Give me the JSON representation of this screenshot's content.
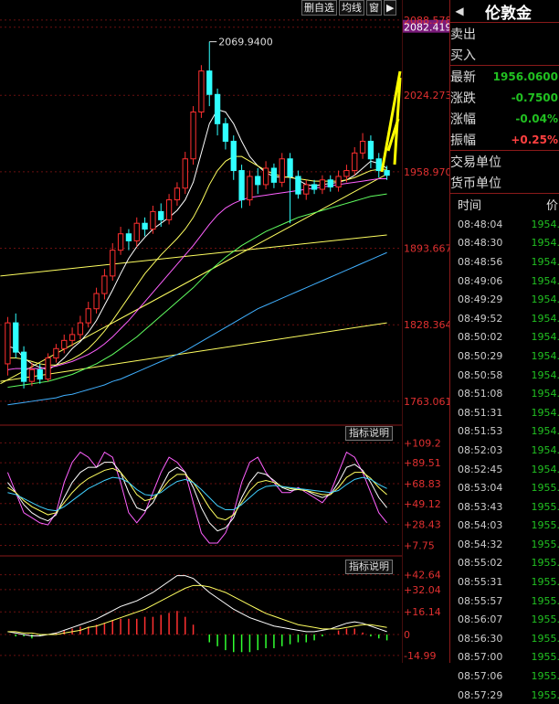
{
  "toolbar": {
    "delete": "删自选",
    "ma": "均线",
    "window": "窗",
    "arrow": "▶"
  },
  "panel": {
    "arrow": "◀",
    "title": "伦敦金",
    "sell": "卖出",
    "buy": "买入",
    "latest_label": "最新",
    "latest": "1956.0600",
    "change_label": "涨跌",
    "change": "-0.7500",
    "pct_label": "涨幅",
    "pct": "-0.04%",
    "amp_label": "振幅",
    "amp": "+0.25%",
    "trade_unit": "交易单位",
    "currency_unit": "货币单位",
    "time_header": "时间",
    "price_header": "价",
    "ticks": [
      {
        "t": "08:48:04",
        "p": "1954."
      },
      {
        "t": "08:48:30",
        "p": "1954."
      },
      {
        "t": "08:48:56",
        "p": "1954."
      },
      {
        "t": "08:49:06",
        "p": "1954."
      },
      {
        "t": "08:49:29",
        "p": "1954."
      },
      {
        "t": "08:49:52",
        "p": "1954."
      },
      {
        "t": "08:50:02",
        "p": "1954."
      },
      {
        "t": "08:50:29",
        "p": "1954."
      },
      {
        "t": "08:50:58",
        "p": "1954."
      },
      {
        "t": "08:51:08",
        "p": "1954."
      },
      {
        "t": "08:51:31",
        "p": "1954."
      },
      {
        "t": "08:51:53",
        "p": "1954."
      },
      {
        "t": "08:52:03",
        "p": "1954."
      },
      {
        "t": "08:52:45",
        "p": "1954."
      },
      {
        "t": "08:53:04",
        "p": "1955."
      },
      {
        "t": "08:53:43",
        "p": "1955."
      },
      {
        "t": "08:54:03",
        "p": "1955."
      },
      {
        "t": "08:54:32",
        "p": "1955."
      },
      {
        "t": "08:55:02",
        "p": "1955."
      },
      {
        "t": "08:55:31",
        "p": "1955."
      },
      {
        "t": "08:55:57",
        "p": "1955."
      },
      {
        "t": "08:56:07",
        "p": "1955."
      },
      {
        "t": "08:56:30",
        "p": "1955."
      },
      {
        "t": "08:57:00",
        "p": "1955."
      },
      {
        "t": "08:57:06",
        "p": "1955."
      },
      {
        "t": "08:57:29",
        "p": "1955."
      }
    ]
  },
  "indicator_btn": "指标说明",
  "chart_data": [
    {
      "type": "candlestick",
      "high_label": "2069.9400",
      "y_ticks": [
        "2088.578",
        "2082.419",
        "2024.273",
        "1958.970",
        "1893.667",
        "1828.364",
        "1763.061"
      ],
      "ylim": [
        1745,
        2090
      ],
      "candles": [
        [
          1795,
          1830,
          1785,
          1835
        ],
        [
          1830,
          1805,
          1800,
          1838
        ],
        [
          1805,
          1780,
          1774,
          1810
        ],
        [
          1780,
          1790,
          1776,
          1796
        ],
        [
          1790,
          1782,
          1778,
          1795
        ],
        [
          1782,
          1800,
          1780,
          1804
        ],
        [
          1800,
          1808,
          1796,
          1812
        ],
        [
          1808,
          1815,
          1804,
          1820
        ],
        [
          1815,
          1820,
          1810,
          1826
        ],
        [
          1820,
          1830,
          1816,
          1836
        ],
        [
          1830,
          1842,
          1826,
          1848
        ],
        [
          1842,
          1855,
          1838,
          1860
        ],
        [
          1855,
          1870,
          1850,
          1876
        ],
        [
          1870,
          1892,
          1866,
          1898
        ],
        [
          1892,
          1906,
          1888,
          1912
        ],
        [
          1906,
          1900,
          1892,
          1910
        ],
        [
          1900,
          1915,
          1895,
          1920
        ],
        [
          1915,
          1910,
          1904,
          1920
        ],
        [
          1910,
          1925,
          1906,
          1930
        ],
        [
          1925,
          1918,
          1912,
          1932
        ],
        [
          1918,
          1935,
          1914,
          1940
        ],
        [
          1935,
          1945,
          1930,
          1950
        ],
        [
          1945,
          1970,
          1940,
          1976
        ],
        [
          1970,
          2010,
          1965,
          2015
        ],
        [
          2010,
          2045,
          2005,
          2050
        ],
        [
          2045,
          2025,
          2015,
          2070
        ],
        [
          2025,
          2000,
          1990,
          2030
        ],
        [
          2000,
          1985,
          1978,
          2005
        ],
        [
          1985,
          1960,
          1952,
          1990
        ],
        [
          1960,
          1935,
          1928,
          1965
        ],
        [
          1935,
          1955,
          1930,
          1960
        ],
        [
          1955,
          1948,
          1940,
          1962
        ],
        [
          1948,
          1962,
          1944,
          1968
        ],
        [
          1962,
          1950,
          1945,
          1966
        ],
        [
          1950,
          1970,
          1946,
          1975
        ],
        [
          1970,
          1955,
          1915,
          1975
        ],
        [
          1955,
          1940,
          1936,
          1960
        ],
        [
          1940,
          1948,
          1935,
          1952
        ],
        [
          1948,
          1944,
          1940,
          1952
        ],
        [
          1944,
          1952,
          1940,
          1956
        ],
        [
          1952,
          1946,
          1942,
          1956
        ],
        [
          1946,
          1955,
          1942,
          1960
        ],
        [
          1955,
          1960,
          1950,
          1965
        ],
        [
          1960,
          1975,
          1956,
          1980
        ],
        [
          1975,
          1985,
          1970,
          1992
        ],
        [
          1985,
          1970,
          1962,
          1990
        ],
        [
          1970,
          1960,
          1954,
          1975
        ],
        [
          1960,
          1956,
          1952,
          1964
        ]
      ],
      "moving_averages": [
        {
          "color": "#ffffff",
          "values": [
            1810,
            1808,
            1800,
            1795,
            1792,
            1790,
            1794,
            1800,
            1808,
            1814,
            1822,
            1832,
            1845,
            1858,
            1872,
            1885,
            1895,
            1903,
            1910,
            1915,
            1920,
            1926,
            1935,
            1950,
            1975,
            2000,
            2012,
            2010,
            2000,
            1985,
            1972,
            1964,
            1958,
            1955,
            1954,
            1955,
            1952,
            1948,
            1947,
            1948,
            1949,
            1950,
            1952,
            1956,
            1962,
            1968,
            1966,
            1962
          ]
        },
        {
          "color": "#ffff60",
          "values": [
            1800,
            1800,
            1799,
            1797,
            1795,
            1794,
            1794,
            1796,
            1799,
            1803,
            1808,
            1815,
            1823,
            1832,
            1842,
            1852,
            1862,
            1872,
            1880,
            1888,
            1895,
            1902,
            1910,
            1920,
            1933,
            1948,
            1960,
            1968,
            1972,
            1972,
            1968,
            1964,
            1960,
            1957,
            1955,
            1954,
            1953,
            1952,
            1951,
            1951,
            1951,
            1951,
            1952,
            1954,
            1957,
            1960,
            1961,
            1961
          ]
        },
        {
          "color": "#ff60ff",
          "values": [
            1790,
            1791,
            1791,
            1791,
            1791,
            1792,
            1793,
            1795,
            1797,
            1800,
            1803,
            1807,
            1812,
            1818,
            1825,
            1832,
            1840,
            1848,
            1856,
            1864,
            1872,
            1880,
            1888,
            1896,
            1905,
            1914,
            1922,
            1928,
            1932,
            1935,
            1937,
            1938,
            1939,
            1940,
            1941,
            1942,
            1943,
            1944,
            1945,
            1946,
            1947,
            1948,
            1949,
            1950,
            1951,
            1952,
            1953,
            1953
          ]
        },
        {
          "color": "#60ff60",
          "values": [
            1775,
            1776,
            1777,
            1778,
            1779,
            1780,
            1782,
            1784,
            1786,
            1789,
            1792,
            1795,
            1799,
            1803,
            1808,
            1813,
            1818,
            1824,
            1830,
            1836,
            1842,
            1848,
            1854,
            1860,
            1867,
            1874,
            1880,
            1886,
            1891,
            1896,
            1900,
            1904,
            1908,
            1911,
            1914,
            1917,
            1920,
            1922,
            1924,
            1926,
            1928,
            1930,
            1932,
            1934,
            1936,
            1938,
            1939,
            1940
          ]
        },
        {
          "color": "#40b0ff",
          "values": [
            1760,
            1761,
            1762,
            1763,
            1764,
            1765,
            1766,
            1768,
            1769,
            1771,
            1773,
            1775,
            1777,
            1780,
            1782,
            1785,
            1788,
            1791,
            1794,
            1797,
            1800,
            1803,
            1806,
            1810,
            1814,
            1818,
            1822,
            1826,
            1830,
            1834,
            1838,
            1842,
            1845,
            1848,
            1851,
            1854,
            1857,
            1860,
            1863,
            1866,
            1869,
            1872,
            1875,
            1878,
            1881,
            1884,
            1887,
            1890
          ]
        }
      ],
      "trend_lines": [
        {
          "color": "#ffff60",
          "from": [
            0,
            1870
          ],
          "to": [
            47,
            1905
          ]
        },
        {
          "color": "#ffff60",
          "from": [
            0,
            1778
          ],
          "to": [
            47,
            1957
          ]
        },
        {
          "color": "#ffff60",
          "from": [
            0,
            1780
          ],
          "to": [
            47,
            1830
          ]
        }
      ]
    },
    {
      "type": "line",
      "y_ticks": [
        "+109.2",
        "+89.51",
        "+68.83",
        "+49.12",
        "+28.43",
        "+7.75"
      ],
      "ylim": [
        0,
        115
      ],
      "series": [
        {
          "color": "#ff60ff",
          "values": [
            80,
            60,
            40,
            35,
            30,
            28,
            40,
            70,
            90,
            100,
            95,
            85,
            100,
            95,
            70,
            40,
            30,
            40,
            60,
            80,
            95,
            90,
            80,
            50,
            20,
            10,
            10,
            20,
            40,
            70,
            90,
            95,
            80,
            70,
            60,
            60,
            65,
            60,
            55,
            50,
            60,
            80,
            100,
            95,
            80,
            60,
            40,
            30
          ]
        },
        {
          "color": "#ffffff",
          "values": [
            70,
            60,
            48,
            40,
            35,
            32,
            38,
            55,
            70,
            80,
            85,
            85,
            90,
            90,
            80,
            60,
            45,
            42,
            50,
            65,
            80,
            85,
            80,
            65,
            45,
            30,
            22,
            25,
            35,
            55,
            70,
            80,
            78,
            72,
            65,
            62,
            63,
            62,
            58,
            55,
            58,
            70,
            85,
            88,
            82,
            70,
            55,
            45
          ]
        },
        {
          "color": "#ffff60",
          "values": [
            65,
            60,
            52,
            46,
            42,
            38,
            40,
            50,
            60,
            68,
            74,
            78,
            82,
            84,
            80,
            70,
            58,
            52,
            54,
            62,
            72,
            78,
            78,
            70,
            58,
            45,
            35,
            33,
            38,
            50,
            62,
            70,
            72,
            70,
            66,
            64,
            63,
            62,
            60,
            58,
            58,
            65,
            75,
            80,
            80,
            74,
            65,
            58
          ]
        },
        {
          "color": "#40d0ff",
          "values": [
            60,
            58,
            54,
            50,
            46,
            43,
            42,
            46,
            52,
            58,
            64,
            68,
            72,
            75,
            74,
            70,
            63,
            58,
            57,
            60,
            66,
            71,
            73,
            70,
            63,
            55,
            47,
            43,
            43,
            48,
            55,
            62,
            66,
            67,
            66,
            65,
            64,
            63,
            62,
            61,
            60,
            62,
            68,
            73,
            75,
            73,
            68,
            64
          ]
        }
      ]
    },
    {
      "type": "macd",
      "y_ticks": [
        "+42.64",
        "+32.04",
        "+16.14",
        "0",
        "-14.99"
      ],
      "ylim": [
        -17,
        45
      ],
      "dif": [
        2,
        1,
        0,
        -1,
        -1,
        0,
        1,
        3,
        5,
        7,
        9,
        11,
        14,
        17,
        20,
        22,
        24,
        27,
        30,
        34,
        38,
        42,
        42,
        40,
        35,
        30,
        26,
        22,
        18,
        15,
        12,
        10,
        8,
        6,
        5,
        4,
        3,
        2,
        2,
        3,
        4,
        6,
        8,
        9,
        8,
        6,
        4,
        2
      ],
      "dea": [
        2,
        2,
        1,
        1,
        0,
        0,
        0,
        1,
        2,
        3,
        5,
        6,
        8,
        10,
        12,
        14,
        16,
        18,
        21,
        24,
        27,
        30,
        33,
        35,
        35,
        34,
        32,
        30,
        27,
        24,
        21,
        18,
        15,
        13,
        11,
        9,
        7,
        6,
        5,
        4,
        4,
        4,
        5,
        6,
        7,
        7,
        6,
        5
      ],
      "hist": [
        0,
        -1,
        -1,
        -2,
        -1,
        0,
        1,
        2,
        3,
        4,
        4,
        5,
        6,
        7,
        8,
        8,
        8,
        9,
        9,
        10,
        11,
        12,
        9,
        5,
        0,
        -4,
        -6,
        -8,
        -9,
        -9,
        -9,
        -8,
        -7,
        -7,
        -6,
        -5,
        -4,
        -4,
        -3,
        -1,
        0,
        2,
        3,
        3,
        1,
        -1,
        -2,
        -3
      ]
    }
  ]
}
